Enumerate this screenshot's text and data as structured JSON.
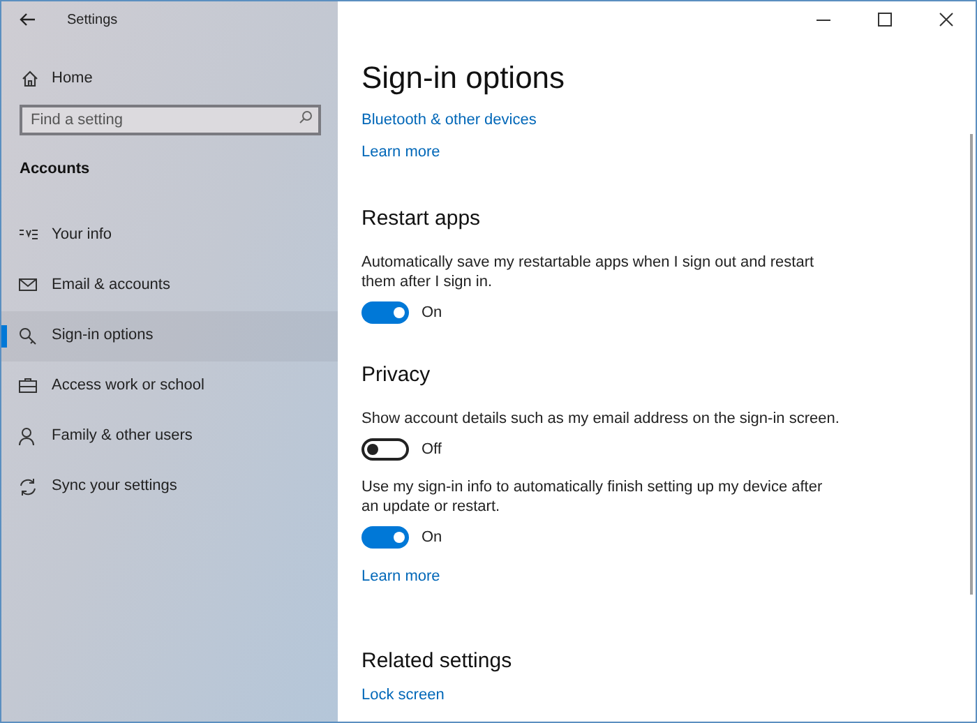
{
  "window": {
    "title": "Settings"
  },
  "sidebar": {
    "home": "Home",
    "search": {
      "placeholder": "Find a setting"
    },
    "section": "Accounts",
    "items": [
      {
        "label": "Your info",
        "selected": false
      },
      {
        "label": "Email & accounts",
        "selected": false
      },
      {
        "label": "Sign-in options",
        "selected": true
      },
      {
        "label": "Access work or school",
        "selected": false
      },
      {
        "label": "Family & other users",
        "selected": false
      },
      {
        "label": "Sync your settings",
        "selected": false
      }
    ]
  },
  "main": {
    "title": "Sign-in options",
    "blocks": [
      {
        "kind": "link",
        "text": "Bluetooth & other devices"
      },
      {
        "kind": "link",
        "text": "Learn more"
      },
      {
        "kind": "heading",
        "text": "Restart apps"
      },
      {
        "kind": "toggle",
        "description": "Automatically save my restartable apps when I sign out and restart them after I sign in.",
        "on": true,
        "state_label": "On"
      },
      {
        "kind": "heading",
        "text": "Privacy"
      },
      {
        "kind": "toggle",
        "description": "Show account details such as my email address on the sign-in screen.",
        "on": false,
        "state_label": "Off"
      },
      {
        "kind": "toggle",
        "description": "Use my sign-in info to automatically finish setting up my device after an update or restart.",
        "on": true,
        "state_label": "On"
      },
      {
        "kind": "link",
        "text": "Learn more"
      },
      {
        "kind": "heading",
        "text": "Related settings"
      },
      {
        "kind": "link",
        "text": "Lock screen"
      }
    ]
  }
}
